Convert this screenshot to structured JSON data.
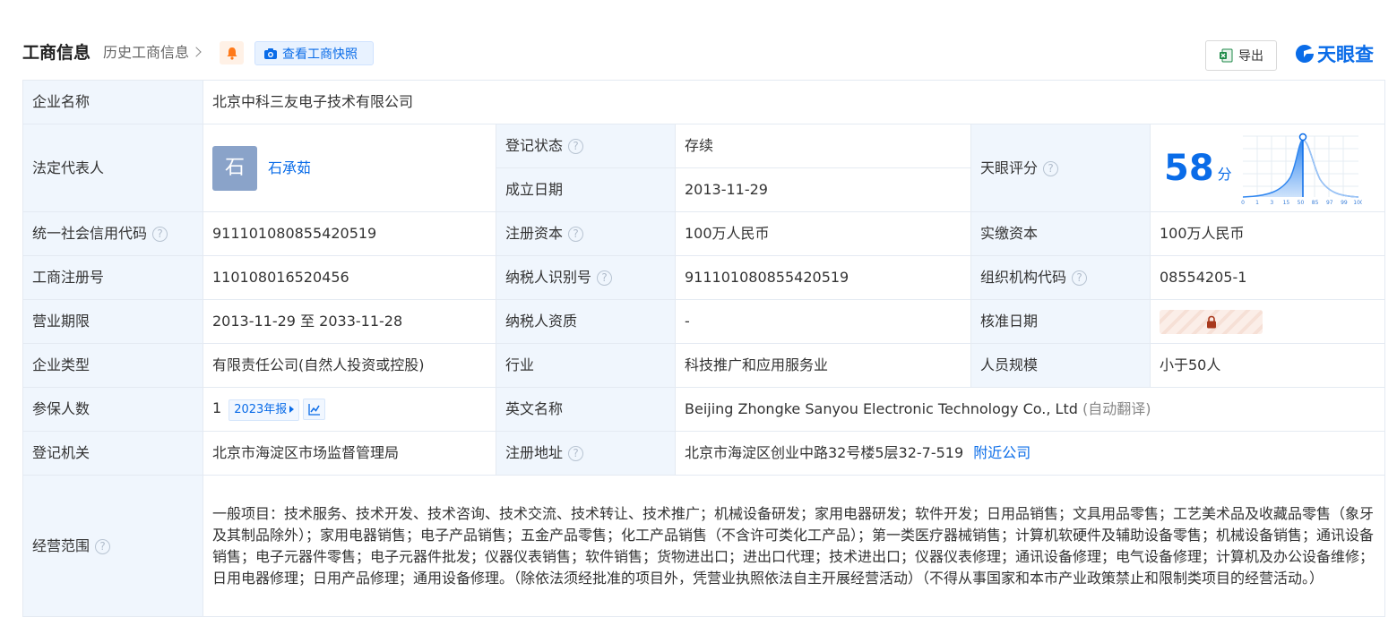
{
  "header": {
    "title": "工商信息",
    "history_link": "历史工商信息",
    "snapshot_button": "查看工商快照",
    "export_button": "导出",
    "logo_text": "天眼查"
  },
  "colors": {
    "accent": "#0a6ce8",
    "label_bg": "#f0f6fd",
    "status_green": "#2ca84c",
    "bell_orange": "#ff7a1a"
  },
  "rows": {
    "company_name": {
      "label": "企业名称",
      "value": "北京中科三友电子技术有限公司"
    },
    "legal_rep": {
      "label": "法定代表人",
      "avatar_char": "石",
      "name": "石承茹"
    },
    "reg_status": {
      "label": "登记状态",
      "value": "存续"
    },
    "founded": {
      "label": "成立日期",
      "value": "2013-11-29"
    },
    "score": {
      "label": "天眼评分",
      "value": "58",
      "unit": "分",
      "axis_ticks": [
        "0",
        "1",
        "3",
        "15",
        "50",
        "85",
        "97",
        "99",
        "100"
      ]
    },
    "credit_code": {
      "label": "统一社会信用代码",
      "value": "911101080855420519"
    },
    "reg_capital": {
      "label": "注册资本",
      "value": "100万人民币"
    },
    "paid_capital": {
      "label": "实缴资本",
      "value": "100万人民币"
    },
    "reg_no": {
      "label": "工商注册号",
      "value": "110108016520456"
    },
    "taxpayer_id": {
      "label": "纳税人识别号",
      "value": "911101080855420519"
    },
    "org_code": {
      "label": "组织机构代码",
      "value": "08554205-1"
    },
    "term": {
      "label": "营业期限",
      "value": "2013-11-29 至 2033-11-28"
    },
    "taxpayer_qual": {
      "label": "纳税人资质",
      "value": "-"
    },
    "approval_date": {
      "label": "核准日期"
    },
    "company_type": {
      "label": "企业类型",
      "value": "有限责任公司(自然人投资或控股)"
    },
    "industry": {
      "label": "行业",
      "value": "科技推广和应用服务业"
    },
    "staff_size": {
      "label": "人员规模",
      "value": "小于50人"
    },
    "insured": {
      "label": "参保人数",
      "value": "1",
      "report_tag": "2023年报"
    },
    "english_name": {
      "label": "英文名称",
      "value": "Beijing Zhongke Sanyou Electronic Technology Co., Ltd",
      "note": "(自动翻译)"
    },
    "reg_authority": {
      "label": "登记机关",
      "value": "北京市海淀区市场监督管理局"
    },
    "reg_address": {
      "label": "注册地址",
      "value": "北京市海淀区创业中路32号楼5层32-7-519",
      "link": "附近公司"
    },
    "business_scope": {
      "label": "经营范围",
      "value": "一般项目：技术服务、技术开发、技术咨询、技术交流、技术转让、技术推广；机械设备研发；家用电器研发；软件开发；日用品销售；文具用品零售；工艺美术品及收藏品零售（象牙及其制品除外）；家用电器销售；电子产品销售；五金产品零售；化工产品销售（不含许可类化工产品）；第一类医疗器械销售；计算机软硬件及辅助设备零售；机械设备销售；通讯设备销售；电子元器件零售；电子元器件批发；仪器仪表销售；软件销售；货物进出口；进出口代理；技术进出口；仪器仪表修理；通讯设备修理；电气设备修理；计算机及办公设备维修；日用电器修理；日用产品修理；通用设备修理。（除依法须经批准的项目外，凭营业执照依法自主开展经营活动）（不得从事国家和本市产业政策禁止和限制类项目的经营活动。）"
    }
  }
}
